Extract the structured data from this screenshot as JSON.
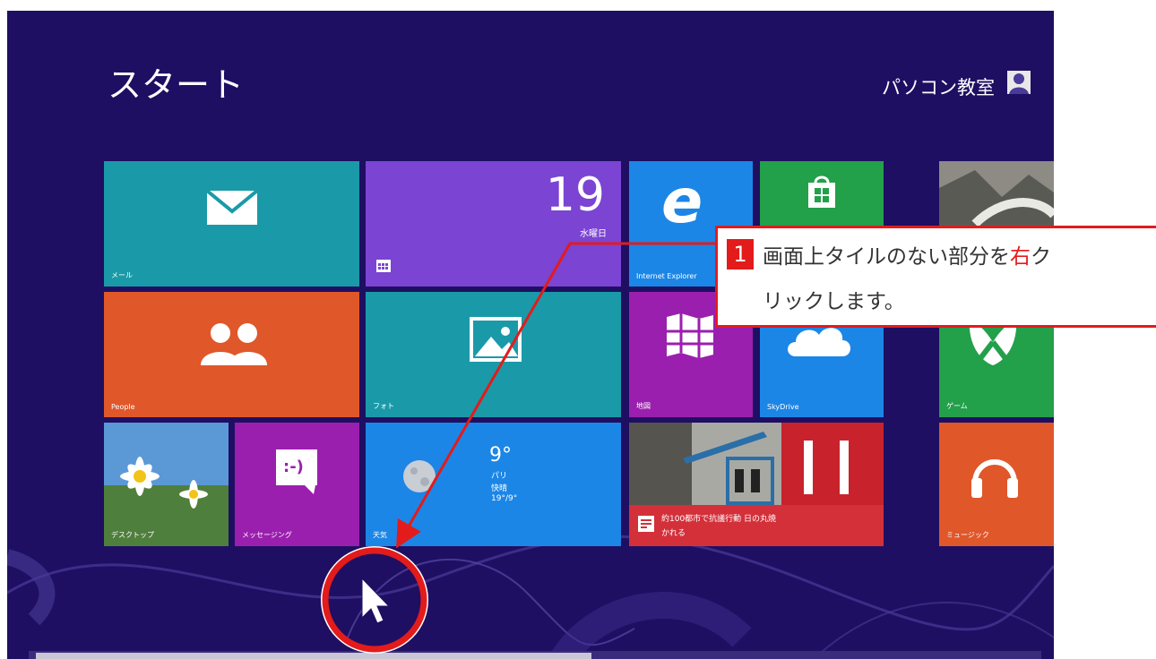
{
  "start": {
    "title": "スタート"
  },
  "user": {
    "name": "パソコン教室"
  },
  "tiles": {
    "mail": {
      "label": "メール"
    },
    "calendar": {
      "day": "19",
      "weekday": "水曜日"
    },
    "ie": {
      "label": "Internet Explorer"
    },
    "people": {
      "label": "People"
    },
    "photos": {
      "label": "フォト"
    },
    "maps": {
      "label": "地図"
    },
    "skydrive": {
      "label": "SkyDrive"
    },
    "games": {
      "label": "ゲーム"
    },
    "desktop": {
      "label": "デスクトップ"
    },
    "messaging": {
      "label": "メッセージング",
      "face": ":-)"
    },
    "weather": {
      "temp": "9°",
      "city": "パリ",
      "condition": "快晴",
      "range": "19°/9°",
      "label": "天気"
    },
    "news": {
      "headline": "約100都市で抗議行動 日の丸焼",
      "headline2": "かれる"
    },
    "music": {
      "label": "ミュージック"
    }
  },
  "callout": {
    "number": "1",
    "line1_before": "画面上タイルのない部分を",
    "line1_red": "右",
    "line1_after": "ク",
    "line2": "リックします。"
  },
  "colors": {
    "background": "#1e0f62",
    "teal": "#1a9aa8",
    "purple": "#7b44d3",
    "blue": "#1c86e6",
    "green": "#23a04a",
    "orange": "#e0572a",
    "magenta": "#9b1fae",
    "accent_red": "#e31b1b"
  }
}
